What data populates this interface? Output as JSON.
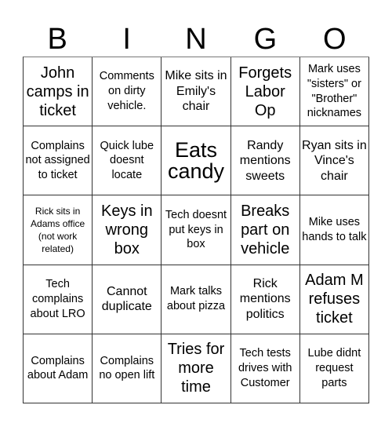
{
  "header": {
    "letters": [
      "B",
      "I",
      "N",
      "G",
      "O"
    ]
  },
  "cells": [
    "John camps in ticket",
    "Comments on dirty vehicle.",
    "Mike sits in Emily's chair",
    "Forgets Labor Op",
    "Mark uses \"sisters\" or \"Brother\" nicknames",
    "Complains not assigned to ticket",
    "Quick lube doesnt locate",
    "Eats candy",
    "Randy mentions sweets",
    "Ryan sits in Vince's chair",
    "Rick sits in Adams office (not work related)",
    "Keys in wrong box",
    "Tech doesnt put keys in box",
    "Breaks part on vehicle",
    "Mike uses hands to talk",
    "Tech complains about LRO",
    "Cannot duplicate",
    "Mark talks about pizza",
    "Rick mentions politics",
    "Adam M refuses ticket",
    "Complains about Adam",
    "Complains no open lift",
    "Tries for more time",
    "Tech tests drives with Customer",
    "Lube didnt request parts"
  ]
}
